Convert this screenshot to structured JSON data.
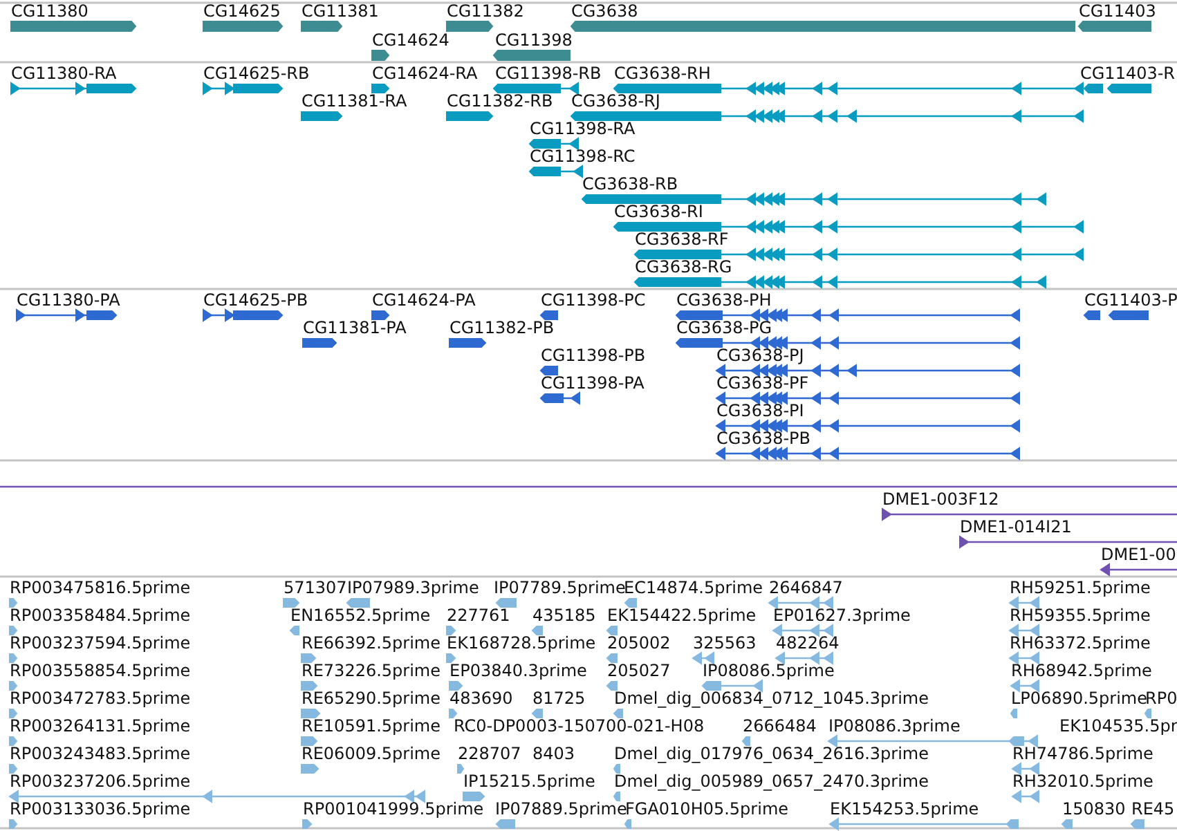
{
  "tracks": [
    {
      "kind": "gene",
      "features": [
        {
          "label": "CG11380",
          "reverse": false
        },
        {
          "label": "CG14625",
          "reverse": false
        },
        {
          "label": "CG11381",
          "reverse": false
        },
        {
          "label": "CG11382",
          "reverse": false
        },
        {
          "label": "CG3638",
          "reverse": true
        },
        {
          "label": "CG11403",
          "reverse": true
        },
        {
          "label": "CG14624",
          "reverse": false
        },
        {
          "label": "CG11398",
          "reverse": true
        }
      ]
    },
    {
      "kind": "transcript",
      "features": [
        {
          "label": "CG11380-RA",
          "reverse": false
        },
        {
          "label": "CG14625-RB",
          "reverse": false
        },
        {
          "label": "CG14624-RA",
          "reverse": false
        },
        {
          "label": "CG11398-RB",
          "reverse": true
        },
        {
          "label": "CG3638-RH",
          "reverse": true
        },
        {
          "label": "CG11403-R",
          "reverse": true
        },
        {
          "label": "CG11381-RA",
          "reverse": false
        },
        {
          "label": "CG11382-RB",
          "reverse": false
        },
        {
          "label": "CG3638-RJ",
          "reverse": true
        },
        {
          "label": "CG11398-RA",
          "reverse": true
        },
        {
          "label": "CG11398-RC",
          "reverse": true
        },
        {
          "label": "CG3638-RB",
          "reverse": true
        },
        {
          "label": "CG3638-RI",
          "reverse": true
        },
        {
          "label": "CG3638-RF",
          "reverse": true
        },
        {
          "label": "CG3638-RG",
          "reverse": true
        }
      ]
    },
    {
      "kind": "protein",
      "features": [
        {
          "label": "CG11380-PA",
          "reverse": false
        },
        {
          "label": "CG14625-PB",
          "reverse": false
        },
        {
          "label": "CG14624-PA",
          "reverse": false
        },
        {
          "label": "CG11398-PC",
          "reverse": true
        },
        {
          "label": "CG3638-PH",
          "reverse": true
        },
        {
          "label": "CG11403-P",
          "reverse": true
        },
        {
          "label": "CG11381-PA",
          "reverse": false
        },
        {
          "label": "CG11382-PB",
          "reverse": false
        },
        {
          "label": "CG3638-PG",
          "reverse": true
        },
        {
          "label": "CG11398-PB",
          "reverse": true
        },
        {
          "label": "CG3638-PJ",
          "reverse": true
        },
        {
          "label": "CG11398-PA",
          "reverse": true
        },
        {
          "label": "CG3638-PF",
          "reverse": true
        },
        {
          "label": "CG3638-PI",
          "reverse": true
        },
        {
          "label": "CG3638-PB",
          "reverse": true
        }
      ]
    },
    {
      "kind": "clone",
      "features": [
        {
          "kind": "span"
        },
        {
          "label": "DME1-003F12",
          "reverse": false
        },
        {
          "label": "DME1-014I21",
          "reverse": false
        },
        {
          "label": "DME1-00",
          "reverse": true
        }
      ]
    },
    {
      "kind": "est",
      "features": [
        {
          "label": "RP003475816.5prime",
          "reverse": false
        },
        {
          "label": "571307",
          "reverse": false
        },
        {
          "label": "IP07989.3prime",
          "reverse": true
        },
        {
          "label": "IP07789.5prime",
          "reverse": true
        },
        {
          "label": "EC14874.5prime",
          "reverse": true
        },
        {
          "label": "2646847",
          "reverse": true
        },
        {
          "label": "RH59251.5prime",
          "reverse": true
        },
        {
          "label": "RP003358484.5prime",
          "reverse": false
        },
        {
          "label": "EN16552.5prime",
          "reverse": true
        },
        {
          "label": "227761",
          "reverse": false
        },
        {
          "label": "435185",
          "reverse": true
        },
        {
          "label": "EK154422.5prime",
          "reverse": true
        },
        {
          "label": "EP01627.3prime",
          "reverse": true
        },
        {
          "label": "RH59355.5prime",
          "reverse": true
        },
        {
          "label": "RP003237594.5prime",
          "reverse": false
        },
        {
          "label": "RE66392.5prime",
          "reverse": false
        },
        {
          "label": "EK168728.5prime",
          "reverse": false
        },
        {
          "label": "205002",
          "reverse": true
        },
        {
          "label": "325563",
          "reverse": true
        },
        {
          "label": "482264",
          "reverse": true
        },
        {
          "label": "RH63372.5prime",
          "reverse": true
        },
        {
          "label": "RP003558854.5prime",
          "reverse": false
        },
        {
          "label": "RE73226.5prime",
          "reverse": false
        },
        {
          "label": "EP03840.3prime",
          "reverse": false
        },
        {
          "label": "205027",
          "reverse": true
        },
        {
          "label": "IP08086.5prime",
          "reverse": true
        },
        {
          "label": "RH68942.5prime",
          "reverse": true
        },
        {
          "label": "RP003472783.5prime",
          "reverse": false
        },
        {
          "label": "RE65290.5prime",
          "reverse": false
        },
        {
          "label": "483690",
          "reverse": false
        },
        {
          "label": "81725",
          "reverse": true
        },
        {
          "label": "Dmel_dig_006834_0712_1045.3prime",
          "reverse": true
        },
        {
          "label": "LP06890.5prime",
          "reverse": true
        },
        {
          "label": "RP0",
          "reverse": true
        },
        {
          "label": "RP003264131.5prime",
          "reverse": false
        },
        {
          "label": "RE10591.5prime",
          "reverse": false
        },
        {
          "label": "RC0-DP0003-150700-021-H08"
        },
        {
          "label": "2666484",
          "reverse": true
        },
        {
          "label": "IP08086.3prime",
          "reverse": true
        },
        {
          "label": "EK104535.5pr"
        },
        {
          "label": "RP003243483.5prime",
          "reverse": false
        },
        {
          "label": "RE06009.5prime",
          "reverse": false
        },
        {
          "label": "228707",
          "reverse": false
        },
        {
          "label": "8403"
        },
        {
          "label": "Dmel_dig_017976_0634_2616.3prime",
          "reverse": true
        },
        {
          "label": "RH74786.5prime",
          "reverse": true
        },
        {
          "label": "RP003237206.5prime",
          "reverse": true
        },
        {
          "label": "IP15215.5prime",
          "reverse": false
        },
        {
          "label": "Dmel_dig_005989_0657_2470.3prime",
          "reverse": true
        },
        {
          "label": "RH32010.5prime",
          "reverse": true
        },
        {
          "label": "RP003133036.5prime",
          "reverse": false
        },
        {
          "label": "RP001041999.5prime",
          "reverse": false
        },
        {
          "label": "IP07889.5prime",
          "reverse": true
        },
        {
          "label": "FGA010H05.5prime",
          "reverse": true
        },
        {
          "label": "EK154253.5prime",
          "reverse": true
        },
        {
          "label": "150830",
          "reverse": true
        },
        {
          "label": "RE45",
          "reverse": true
        }
      ]
    }
  ]
}
